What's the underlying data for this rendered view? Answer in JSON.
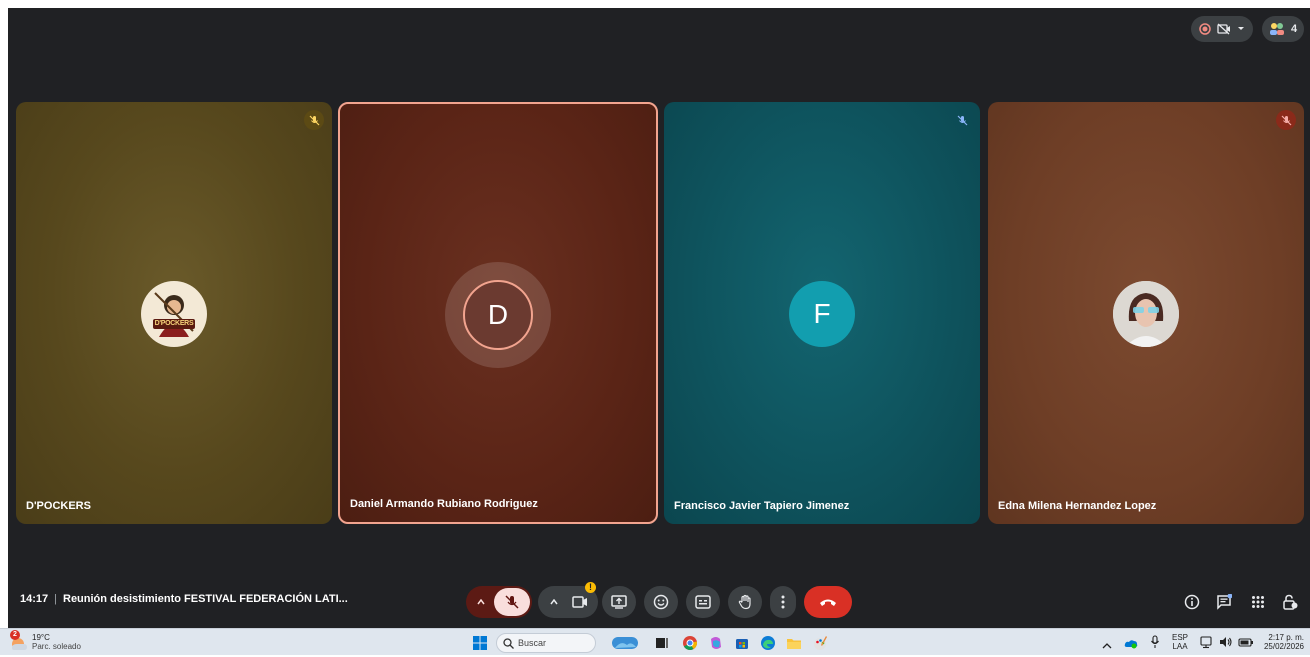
{
  "header": {
    "participant_count": "4"
  },
  "participants": [
    {
      "name": "D'POCKERS",
      "avatar_text": "D'POCKERS",
      "bg": "#5a4a1e"
    },
    {
      "name": "Daniel Armando Rubiano Rodriguez",
      "avatar_initial": "D",
      "bg": "#5a2416",
      "speaking": true
    },
    {
      "name": "Francisco Javier Tapiero Jimenez",
      "avatar_initial": "F",
      "bg": "#0e525c"
    },
    {
      "name": "Edna Milena Hernandez Lopez",
      "bg": "#6e3e26"
    }
  ],
  "meeting": {
    "time": "14:17",
    "separator": "|",
    "title": "Reunión desistimiento FESTIVAL FEDERACIÓN LATI..."
  },
  "controls": {
    "camera_warning": "!",
    "colors": {
      "mic_off_bg": "#f9dedc",
      "end_call": "#d93025",
      "bar_bg": "#3c4043"
    }
  },
  "taskbar": {
    "weather_temp": "19°C",
    "weather_desc": "Parc. soleado",
    "weather_badge": "2",
    "search_placeholder": "Buscar",
    "lang_top": "ESP",
    "lang_bottom": "LAA",
    "clock_time": "2:17 p. m.",
    "clock_date": "25/02/2026"
  }
}
